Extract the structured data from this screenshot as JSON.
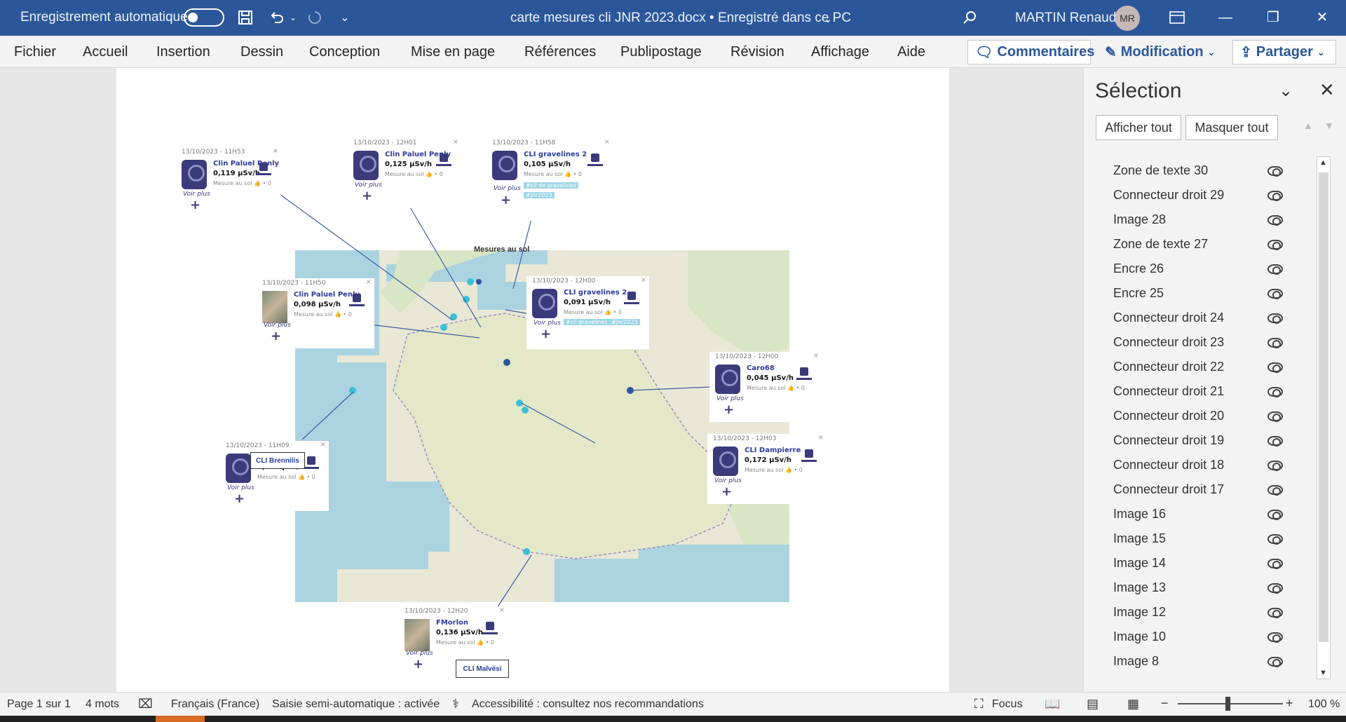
{
  "titlebar": {
    "autosave_label": "Enregistrement automatique",
    "document_title": "carte mesures cli JNR 2023.docx • Enregistré dans ce PC",
    "user_name": "MARTIN Renaud",
    "user_initials": "MR"
  },
  "menu": {
    "items": [
      "Fichier",
      "Accueil",
      "Insertion",
      "Dessin",
      "Conception",
      "Mise en page",
      "Références",
      "Publipostage",
      "Révision",
      "Affichage",
      "Aide"
    ],
    "comments_label": "Commentaires",
    "edit_label": "Modification",
    "share_label": "Partager"
  },
  "document": {
    "map_title": "Mesures au sol",
    "cards": [
      {
        "time": "13/10/2023 - 11H53",
        "name": "Clin Paluel Penly",
        "value": "0,119 µSv/h"
      },
      {
        "time": "13/10/2023 - 12H01",
        "name": "Clin Paluel Penly",
        "value": "0,125 µSv/h"
      },
      {
        "time": "13/10/2023 - 11H58",
        "name": "CLI gravelines 2",
        "value": "0,105 µSv/h",
        "tags": [
          "#cli de gravelines",
          "#jnr2023"
        ]
      },
      {
        "time": "13/10/2023 - 11H50",
        "name": "Clin Paluel Penly",
        "value": "0,098 µSv/h"
      },
      {
        "time": "13/10/2023 - 12H00",
        "name": "CLI gravelines 2",
        "value": "0,091 µSv/h",
        "tags": [
          "#cli gravelines",
          "#jnr2023"
        ]
      },
      {
        "time": "13/10/2023 - 12H00",
        "name": "Caro68",
        "value": "0,045 µSv/h"
      },
      {
        "time": "13/10/2023 - 11H09",
        "name": "",
        "value": "0,157 µSv/h"
      },
      {
        "time": "13/10/2023 - 12H03",
        "name": "CLI Dampierre",
        "value": "0,172 µSv/h"
      },
      {
        "time": "13/10/2023 - 12H20",
        "name": "FMorlon",
        "value": "0,136 µSv/h"
      }
    ],
    "measure_label": "Mesure au sol 👍 • 0",
    "see_more": "Voir plus",
    "plus": "+",
    "close": "×",
    "textbox_brennilis": "CLI Brennilis",
    "textbox_malvesi": "CLI Malvési"
  },
  "selection_panel": {
    "title": "Sélection",
    "show_all": "Afficher tout",
    "hide_all": "Masquer tout",
    "items": [
      "Zone de texte 30",
      "Connecteur droit 29",
      "Image 28",
      "Zone de texte 27",
      "Encre 26",
      "Encre 25",
      "Connecteur droit 24",
      "Connecteur droit 23",
      "Connecteur droit 22",
      "Connecteur droit 21",
      "Connecteur droit 20",
      "Connecteur droit 19",
      "Connecteur droit 18",
      "Connecteur droit 17",
      "Image 16",
      "Image 15",
      "Image 14",
      "Image 13",
      "Image 12",
      "Image 10",
      "Image 8"
    ]
  },
  "status": {
    "page": "Page 1 sur 1",
    "words": "4 mots",
    "language": "Français (France)",
    "autocomplete": "Saisie semi-automatique : activée",
    "accessibility": "Accessibilité : consultez nos recommandations",
    "focus": "Focus",
    "zoom": "100 %"
  }
}
